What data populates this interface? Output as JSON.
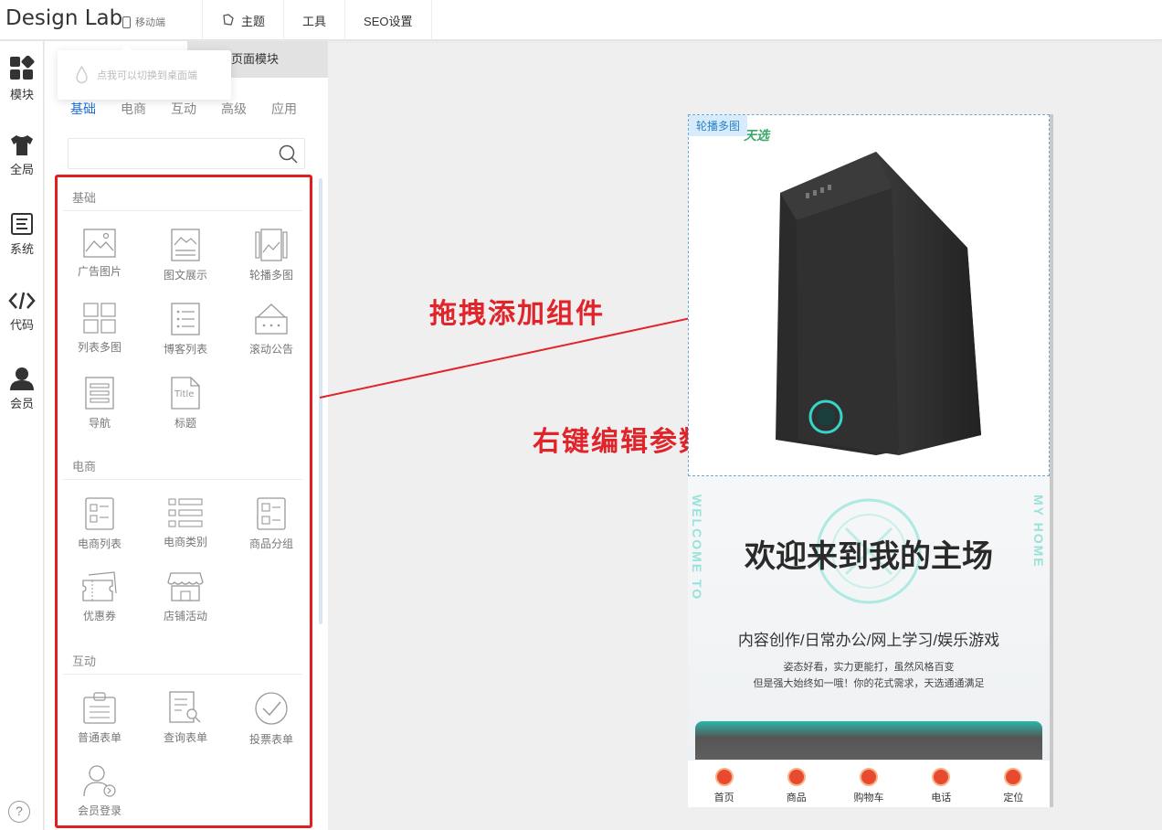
{
  "app": {
    "logo": "Design Lab",
    "mobile_switch": "移动端"
  },
  "topnav": [
    {
      "label": "主题",
      "icon": "theme-icon"
    },
    {
      "label": "工具",
      "icon": ""
    },
    {
      "label": "SEO设置",
      "icon": ""
    }
  ],
  "rail": [
    {
      "label": "模块",
      "icon": "grid-icon"
    },
    {
      "label": "全局",
      "icon": "tshirt-icon"
    },
    {
      "label": "系统",
      "icon": "document-icon"
    },
    {
      "label": "代码",
      "icon": "code-icon"
    },
    {
      "label": "会员",
      "icon": "user-icon"
    }
  ],
  "panel": {
    "tab_right": "页面模块",
    "tooltip": "点我可以切换到桌面端",
    "categories": [
      "基础",
      "电商",
      "互动",
      "高级",
      "应用"
    ],
    "active_category": "基础",
    "search_placeholder": ""
  },
  "sections": {
    "basic": {
      "title": "基础",
      "items": [
        "广告图片",
        "图文展示",
        "轮播多图",
        "列表多图",
        "博客列表",
        "滚动公告",
        "导航",
        "标题"
      ]
    },
    "ecom": {
      "title": "电商",
      "items": [
        "电商列表",
        "电商类别",
        "商品分组",
        "优惠券",
        "店铺活动"
      ]
    },
    "interact": {
      "title": "互动",
      "items": [
        "普通表单",
        "查询表单",
        "投票表单",
        "会员登录"
      ]
    }
  },
  "annotations": {
    "drag": "拖拽添加组件",
    "rightclick": "右键编辑参数"
  },
  "preview": {
    "carousel_tag": "轮播多图",
    "brand": "天选",
    "welcome_title": "欢迎来到我的主场",
    "welcome_sub": "内容创作/日常办公/网上学习/娱乐游戏",
    "desc_line1": "姿态好看，实力更能打，虽然风格百变",
    "desc_line2": "但是强大始终如一哦！你的花式需求，天选通通满足",
    "side_left": "WELCOME TO",
    "side_right": "MY HOME",
    "tabbar": [
      "首页",
      "商品",
      "购物车",
      "电话",
      "定位"
    ]
  },
  "colors": {
    "accent": "#1e6fd9",
    "annotation": "#e0242a",
    "tab_icon": "#e84a2f"
  }
}
